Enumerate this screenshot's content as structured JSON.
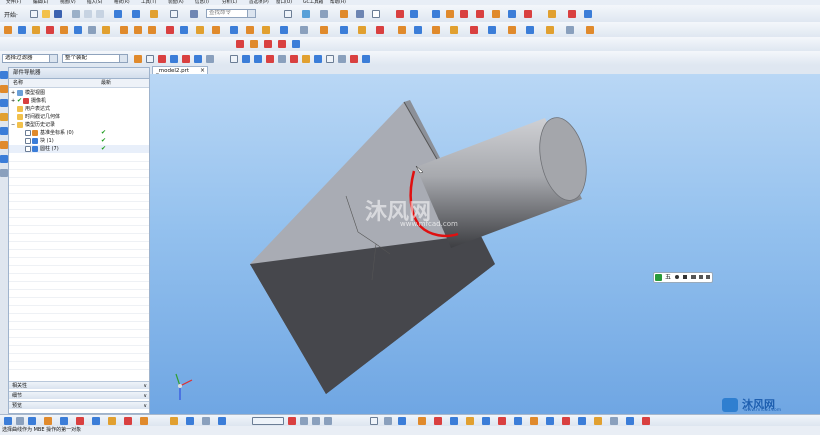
{
  "menubar": {
    "items": [
      "文件(F)",
      "编辑(E)",
      "视图(V)",
      "插入(S)",
      "格式(R)",
      "工具(T)",
      "装配(A)",
      "信息(I)",
      "分析(L)",
      "首选项(P)",
      "窗口(O)",
      "GC工具箱",
      "帮助(H)"
    ]
  },
  "toolbar": {
    "start_label": "开始·",
    "search_placeholder": "查找命令"
  },
  "selection_bar": {
    "filter_value": "选择过滤器",
    "scope_value": "整个装配"
  },
  "doc_tab": {
    "label": "_model2.prt"
  },
  "navigator": {
    "title": "部件导航器",
    "col_name": "名称",
    "col_latest": "最新",
    "tree": [
      {
        "label": "模型视图"
      },
      {
        "label": "摄像机"
      },
      {
        "label": "用户表达式"
      },
      {
        "label": "时间戳记几何体"
      },
      {
        "label": "模型历史记录"
      },
      {
        "label": "基准坐标系 (0)"
      },
      {
        "label": "块 (1)"
      },
      {
        "label": "圆柱 (7)"
      }
    ],
    "panels": [
      "相关性",
      "细节",
      "预览"
    ]
  },
  "status": {
    "text": "选择曲线作为 MBE 操作的第一对象"
  },
  "watermark": {
    "cn": "沐风网",
    "url": "www.mfcad.com",
    "logo_cn": "沐风网",
    "logo_url": "www.mfcad.com"
  },
  "ime": {
    "label": "五"
  },
  "colors": {
    "viewport_top": "#b9d7f5",
    "viewport_bottom": "#6fa6e3",
    "red_curve": "#e01010"
  }
}
